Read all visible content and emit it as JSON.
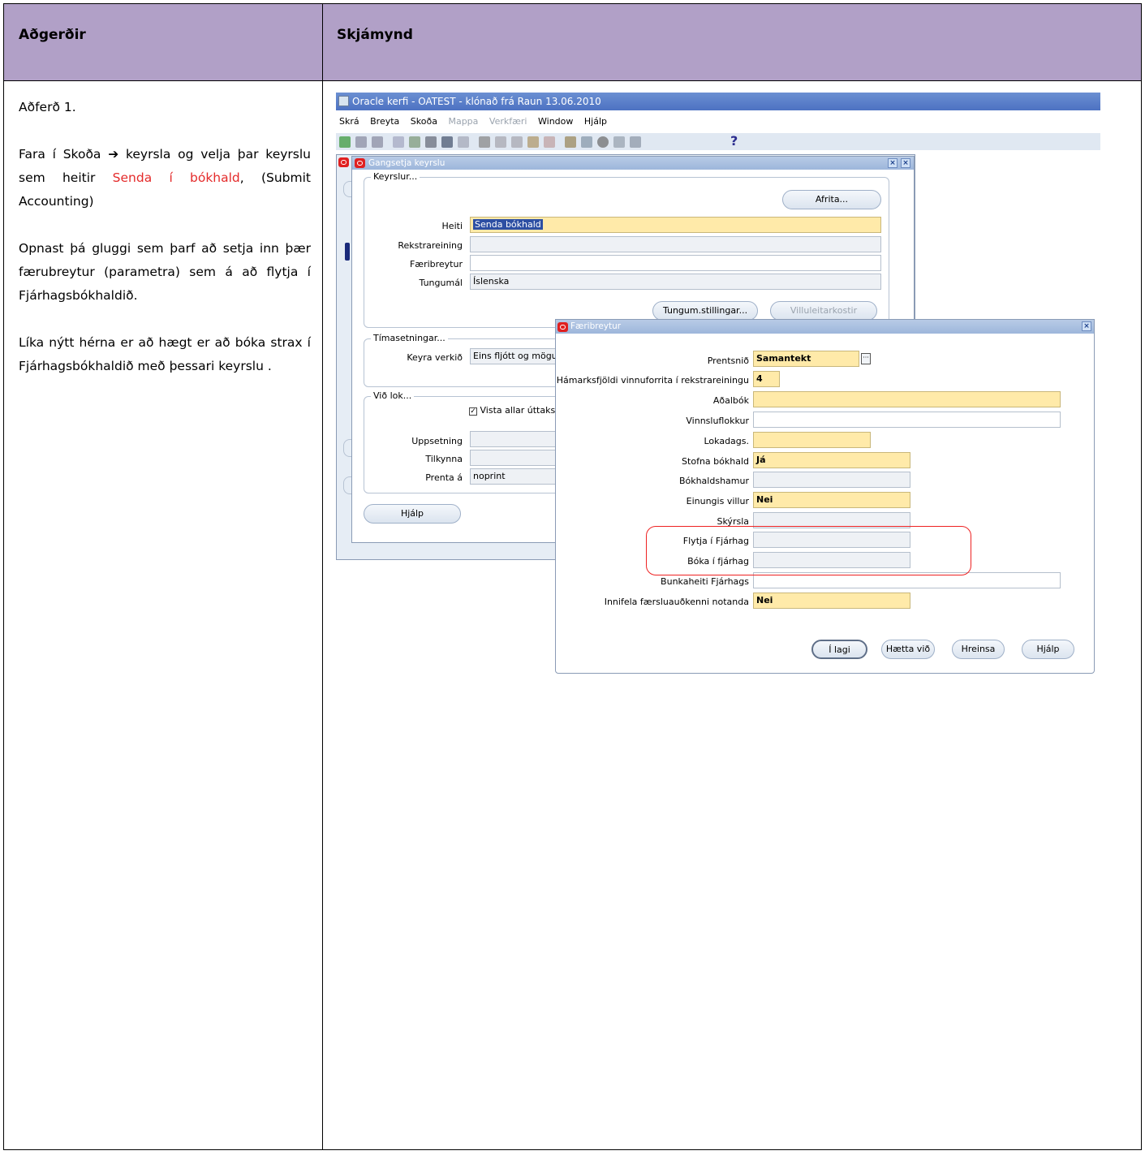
{
  "table": {
    "header_left": "Aðgerðir",
    "header_right": "Skjámynd"
  },
  "instructions": {
    "p1": "Aðferð 1.",
    "p2_a": "Fara í Skoða ",
    "p2_arrow": "➔",
    "p2_b": " keyrsla og velja þar keyrslu sem heitir ",
    "p2_red": "Senda í bókhald",
    "p2_c": ", (Submit Accounting)",
    "p3": "Opnast þá gluggi sem þarf að setja inn þær færubreytur (parametra) sem á að flytja í Fjárhagsbókhaldið.",
    "p4": "Líka nýtt hérna er að hægt er að bóka strax í Fjárhagsbókhaldið með þessari keyrslu ."
  },
  "app": {
    "title": "Oracle kerfi - OATEST - klónað frá Raun 13.06.2010",
    "menu": [
      {
        "label": "Skrá",
        "enabled": true
      },
      {
        "label": "Breyta",
        "enabled": true
      },
      {
        "label": "Skoða",
        "enabled": true
      },
      {
        "label": "Mappa",
        "enabled": false
      },
      {
        "label": "Verkfæri",
        "enabled": false
      },
      {
        "label": "Window",
        "enabled": true
      },
      {
        "label": "Hjálp",
        "enabled": true
      }
    ],
    "help_glyph": "?"
  },
  "run_dialog": {
    "title": "Gangsetja keyrslu",
    "group_keyrslur": "Keyrslur...",
    "copy_button": "Afrita...",
    "heiti_label": "Heiti",
    "heiti_value": "Senda bókhald",
    "rekstrareining_label": "Rekstrareining",
    "rekstrareining_value": "",
    "faeribreytur_label": "Færibreytur",
    "faeribreytur_value": "",
    "tungumal_label": "Tungumál",
    "tungumal_value": "Íslenska",
    "lang_settings_button": "Tungum.stillingar...",
    "debug_options_button": "Villuleitarkostir",
    "group_timasetningar": "Tímasetningar...",
    "keyra_verkid_label": "Keyra verkið",
    "keyra_verkid_value": "Eins fljótt og mögu",
    "group_vid_lok": "Við lok...",
    "save_all_output_label": "Vista allar úttaks",
    "save_all_output_checked": true,
    "uppsetning_label": "Uppsetning",
    "uppsetning_value": "",
    "tilkynna_label": "Tilkynna",
    "tilkynna_value": "",
    "prenta_a_label": "Prenta á",
    "prenta_a_value": "noprint",
    "help_button": "Hjálp"
  },
  "params_dialog": {
    "title": "Færibreytur",
    "fields": [
      {
        "label": "Prentsnið",
        "value": "Samantekt",
        "style": "req"
      },
      {
        "label": "Hámarksfjöldi vinnuforrita í rekstrareiningu",
        "value": "4",
        "style": "req"
      },
      {
        "label": "Aðalbók",
        "value": "",
        "style": "req"
      },
      {
        "label": "Vinnsluflokkur",
        "value": "",
        "style": "white"
      },
      {
        "label": "Lokadags.",
        "value": "",
        "style": "req"
      },
      {
        "label": "Stofna bókhald",
        "value": "Já",
        "style": "req"
      },
      {
        "label": "Bókhaldshamur",
        "value": "",
        "style": "grey"
      },
      {
        "label": "Einungis villur",
        "value": "Nei",
        "style": "req"
      },
      {
        "label": "Skýrsla",
        "value": "",
        "style": "grey"
      },
      {
        "label": "Flytja í Fjárhag",
        "value": "",
        "style": "grey"
      },
      {
        "label": "Bóka í fjárhag",
        "value": "",
        "style": "grey"
      },
      {
        "label": "Bunkaheiti Fjárhags",
        "value": "",
        "style": "white"
      },
      {
        "label": "Innifela færsluauðkenni notanda",
        "value": "Nei",
        "style": "req"
      }
    ],
    "ok_button": "Í lagi",
    "cancel_button": "Hætta við",
    "clear_button": "Hreinsa",
    "help_button": "Hjálp"
  },
  "colors": {
    "header_bg": "#b1a0c7",
    "required_field": "#ffeaa9",
    "highlight": "#e22222",
    "red_text": "#e42b2b"
  }
}
